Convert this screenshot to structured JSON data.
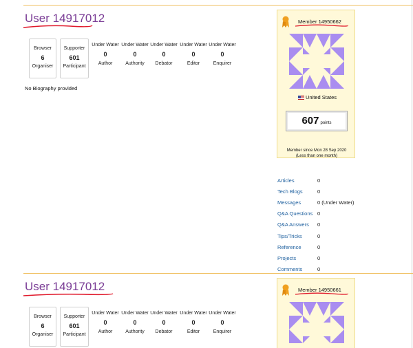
{
  "profiles": [
    {
      "username": "User 14917012",
      "badges": [
        {
          "top": "Browser",
          "num": "6",
          "bottom": "Organiser"
        },
        {
          "top": "Supporter",
          "num": "601",
          "bottom": "Participant"
        }
      ],
      "reputation": [
        {
          "top": "Under Water",
          "num": "0",
          "bottom": "Author"
        },
        {
          "top": "Under Water",
          "num": "0",
          "bottom": "Authority"
        },
        {
          "top": "Under Water",
          "num": "0",
          "bottom": "Debator"
        },
        {
          "top": "Under Water",
          "num": "0",
          "bottom": "Editor"
        },
        {
          "top": "Under Water",
          "num": "0",
          "bottom": "Enquirer"
        }
      ],
      "bio": "No Biography provided",
      "member_label": "Member 14950662",
      "country": "United States",
      "points_value": "607",
      "points_label": "points",
      "member_since": "Member since Mon 28 Sep 2020",
      "member_since_sub": "(Less than one month)",
      "stats": [
        {
          "label": "Articles",
          "value": "0"
        },
        {
          "label": "Tech Blogs",
          "value": "0"
        },
        {
          "label": "Messages",
          "value": "0 (Under Water)"
        },
        {
          "label": "Q&A Questions",
          "value": "0"
        },
        {
          "label": "Q&A Answers",
          "value": "0"
        },
        {
          "label": "Tips/Tricks",
          "value": "0"
        },
        {
          "label": "Reference",
          "value": "0"
        },
        {
          "label": "Projects",
          "value": "0"
        },
        {
          "label": "Comments",
          "value": "0"
        }
      ]
    },
    {
      "username": "User 14917012",
      "badges": [
        {
          "top": "Browser",
          "num": "6",
          "bottom": "Organiser"
        },
        {
          "top": "Supporter",
          "num": "601",
          "bottom": "Participant"
        }
      ],
      "reputation": [
        {
          "top": "Under Water",
          "num": "0",
          "bottom": "Author"
        },
        {
          "top": "Under Water",
          "num": "0",
          "bottom": "Authority"
        },
        {
          "top": "Under Water",
          "num": "0",
          "bottom": "Debator"
        },
        {
          "top": "Under Water",
          "num": "0",
          "bottom": "Editor"
        },
        {
          "top": "Under Water",
          "num": "0",
          "bottom": "Enquirer"
        }
      ],
      "member_label": "Member 14950661"
    }
  ],
  "colors": {
    "username": "#7a3c95",
    "link": "#1d5f9e",
    "card_bg": "#fff9d9",
    "annotation": "#e0182a",
    "avatar": "#a98df0",
    "divider": "#f0c060"
  },
  "icons": [
    "ribbon-badge-icon",
    "us-flag-icon",
    "identicon-avatar"
  ]
}
